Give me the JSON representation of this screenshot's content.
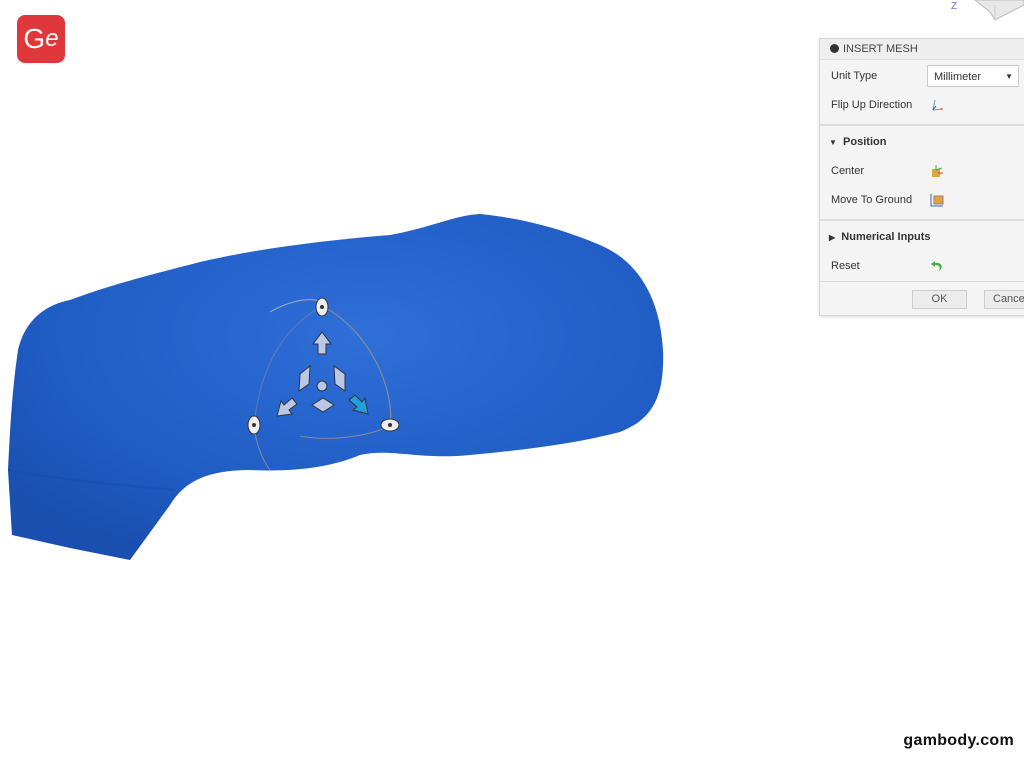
{
  "logo": {
    "text": "G",
    "text2": "e",
    "color": "#e0373b"
  },
  "viewcube": {
    "axis_label": "Z"
  },
  "panel": {
    "title": "INSERT MESH",
    "unit_type_label": "Unit Type",
    "unit_type_value": "Millimeter",
    "flip_up_label": "Flip Up Direction",
    "position_section": "Position",
    "center_label": "Center",
    "move_to_ground_label": "Move To Ground",
    "numerical_section": "Numerical Inputs",
    "reset_label": "Reset",
    "ok_label": "OK",
    "cancel_label": "Cancel"
  },
  "mesh_color": "#1f5cc4",
  "watermark": "gambody.com"
}
